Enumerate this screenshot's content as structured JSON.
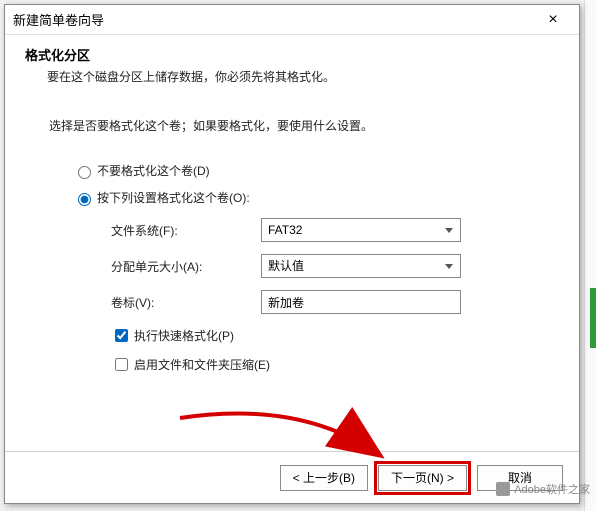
{
  "window": {
    "title": "新建简单卷向导",
    "close": "×"
  },
  "header": {
    "heading": "格式化分区",
    "subheading": "要在这个磁盘分区上储存数据，你必须先将其格式化。"
  },
  "body": {
    "intro": "选择是否要格式化这个卷；如果要格式化，要使用什么设置。",
    "radio_no_format": "不要格式化这个卷(D)",
    "radio_format": "按下列设置格式化这个卷(O):",
    "fs_label": "文件系统(F):",
    "fs_value": "FAT32",
    "alloc_label": "分配单元大小(A):",
    "alloc_value": "默认值",
    "vol_label": "卷标(V):",
    "vol_value": "新加卷",
    "quick_format": "执行快速格式化(P)",
    "compression": "启用文件和文件夹压缩(E)"
  },
  "footer": {
    "back": "< 上一步(B)",
    "next": "下一页(N) >",
    "cancel": "取消"
  },
  "watermark": {
    "text": "Adobe软件之家"
  }
}
